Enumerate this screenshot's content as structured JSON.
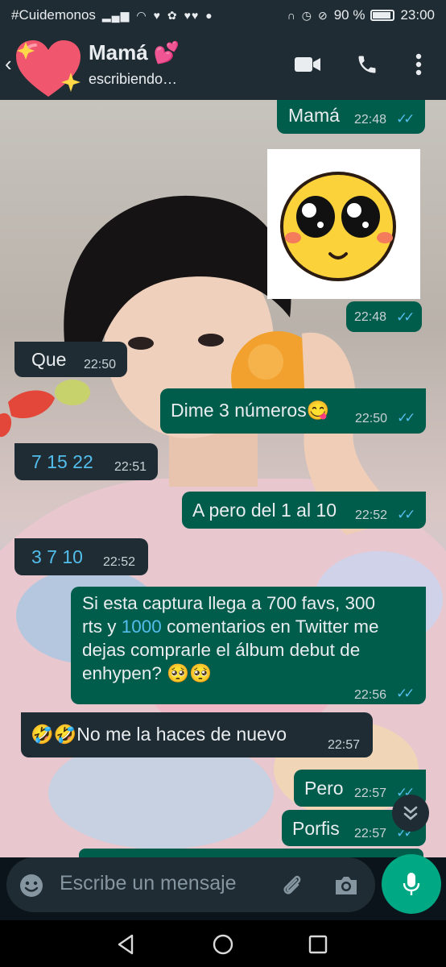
{
  "status_bar": {
    "carrier": "#Cuidemonos",
    "battery": "90 %",
    "battery_level": 0.9,
    "time": "23:00"
  },
  "header": {
    "contact_name": "Mamá 💕",
    "status": "escribiendo…"
  },
  "messages": [
    {
      "dir": "out",
      "text": "Mamá",
      "time": "22:48"
    },
    {
      "dir": "out",
      "type": "sticker",
      "time": "22:48"
    },
    {
      "dir": "in",
      "text": "Que",
      "time": "22:50"
    },
    {
      "dir": "out",
      "text": "Dime 3 números😋",
      "time": "22:50"
    },
    {
      "dir": "in",
      "text": "7 15 22",
      "time": "22:51"
    },
    {
      "dir": "out",
      "text": "A pero del 1 al 10",
      "time": "22:52"
    },
    {
      "dir": "in",
      "text": "3 7 10",
      "time": "22:52"
    },
    {
      "dir": "out",
      "lines": [
        "Si esta captura llega a 700 favs, 300",
        "rts y ",
        "1000",
        " comentarios en Twitter me",
        "dejas comprarle el álbum debut de",
        "enhypen? 🥺🥺"
      ],
      "time": "22:56"
    },
    {
      "dir": "in",
      "text": "🤣🤣No me la haces de nuevo",
      "time": "22:57"
    },
    {
      "dir": "out",
      "text": "Pero",
      "time": "22:57"
    },
    {
      "dir": "out",
      "text": "Porfis",
      "time": "22:57"
    }
  ],
  "read_ticks": "✓✓",
  "input": {
    "placeholder": "Escribe un mensaje"
  },
  "colors": {
    "header_bg": "#1f2c34",
    "outgoing_bubble": "#005c4b",
    "incoming_bubble": "#1f2c34",
    "read_ticks": "#53bdeb",
    "mic_button": "#00a884"
  }
}
